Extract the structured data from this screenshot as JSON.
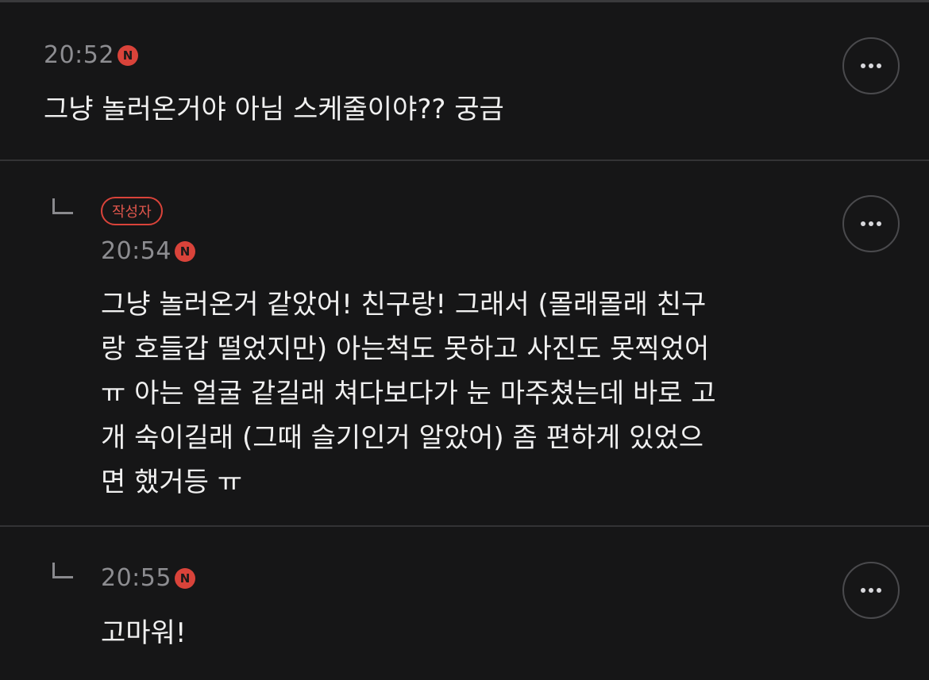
{
  "comments": [
    {
      "time": "20:52",
      "new_badge": "N",
      "text": "그냥 놀러온거야 아님 스케줄이야?? 궁금"
    },
    {
      "author_badge": "작성자",
      "time": "20:54",
      "new_badge": "N",
      "text": "그냥 놀러온거 같았어! 친구랑! 그래서 (몰래몰래 친구\n랑 호들갑 떨었지만) 아는척도 못하고 사진도 못찍었어\nㅠ 아는 얼굴 같길래 쳐다보다가 눈 마주쳤는데 바로 고\n개 숙이길래 (그때 슬기인거 알았어) 좀 편하게 있었으\n면 했거등 ㅠ"
    },
    {
      "time": "20:55",
      "new_badge": "N",
      "text": "고마워!"
    }
  ],
  "colors": {
    "background": "#161617",
    "accent": "#d9433a",
    "time_text": "#8d8d91"
  },
  "icons": {
    "more": "more-horizontal-icon",
    "reply": "reply-arrow-icon"
  }
}
